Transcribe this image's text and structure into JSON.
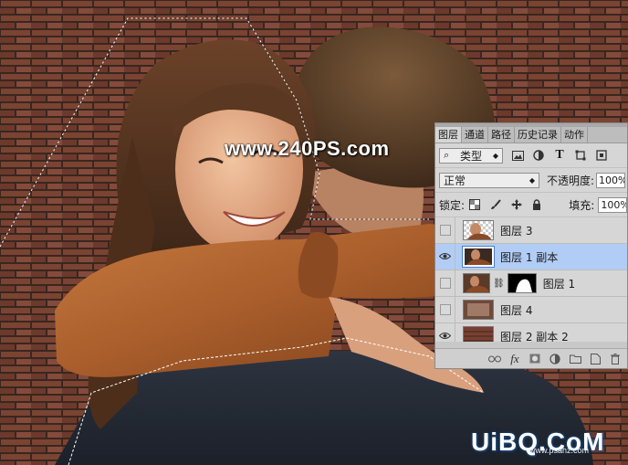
{
  "watermarks": {
    "top": "www.240PS.com",
    "bottom": "UiBQ.CoM",
    "bottom_small": "www.psahz.com"
  },
  "layers_panel": {
    "tabs": [
      {
        "label": "图层"
      },
      {
        "label": "通道"
      },
      {
        "label": "路径"
      },
      {
        "label": "历史记录"
      },
      {
        "label": "动作"
      }
    ],
    "filter_kind": "类型",
    "blend_mode": "正常",
    "opacity_label": "不透明度:",
    "opacity_value": "100%",
    "lock_label": "锁定:",
    "fill_label": "填充:",
    "fill_value": "100%",
    "layers": [
      {
        "name": "图层 3",
        "visible": false,
        "selected": false
      },
      {
        "name": "图层 1 副本",
        "visible": true,
        "selected": true
      },
      {
        "name": "图层 1",
        "visible": false,
        "selected": false
      },
      {
        "name": "图层 4",
        "visible": false,
        "selected": false
      },
      {
        "name": "图层 2 副本 2",
        "visible": true,
        "selected": false
      }
    ],
    "icons": {
      "filter": "search-icon",
      "filter_pixel": "image-filter-icon",
      "filter_adjust": "adjustment-filter-icon",
      "filter_type": "type-filter-icon",
      "filter_shape": "shape-filter-icon",
      "filter_smart": "smart-object-filter-icon",
      "lock_transparent": "lock-transparent-icon",
      "lock_paint": "brush-icon",
      "lock_move": "move-icon",
      "lock_all": "lock-icon",
      "link": "link-icon",
      "fx": "fx-icon",
      "mask": "mask-icon",
      "adjustment": "adjustment-layer-icon",
      "group": "folder-icon",
      "new_layer": "new-layer-icon",
      "delete": "trash-icon"
    },
    "colors": {
      "panel_bg": "#d6d6d6",
      "selected_row": "#b2cdf5"
    }
  }
}
